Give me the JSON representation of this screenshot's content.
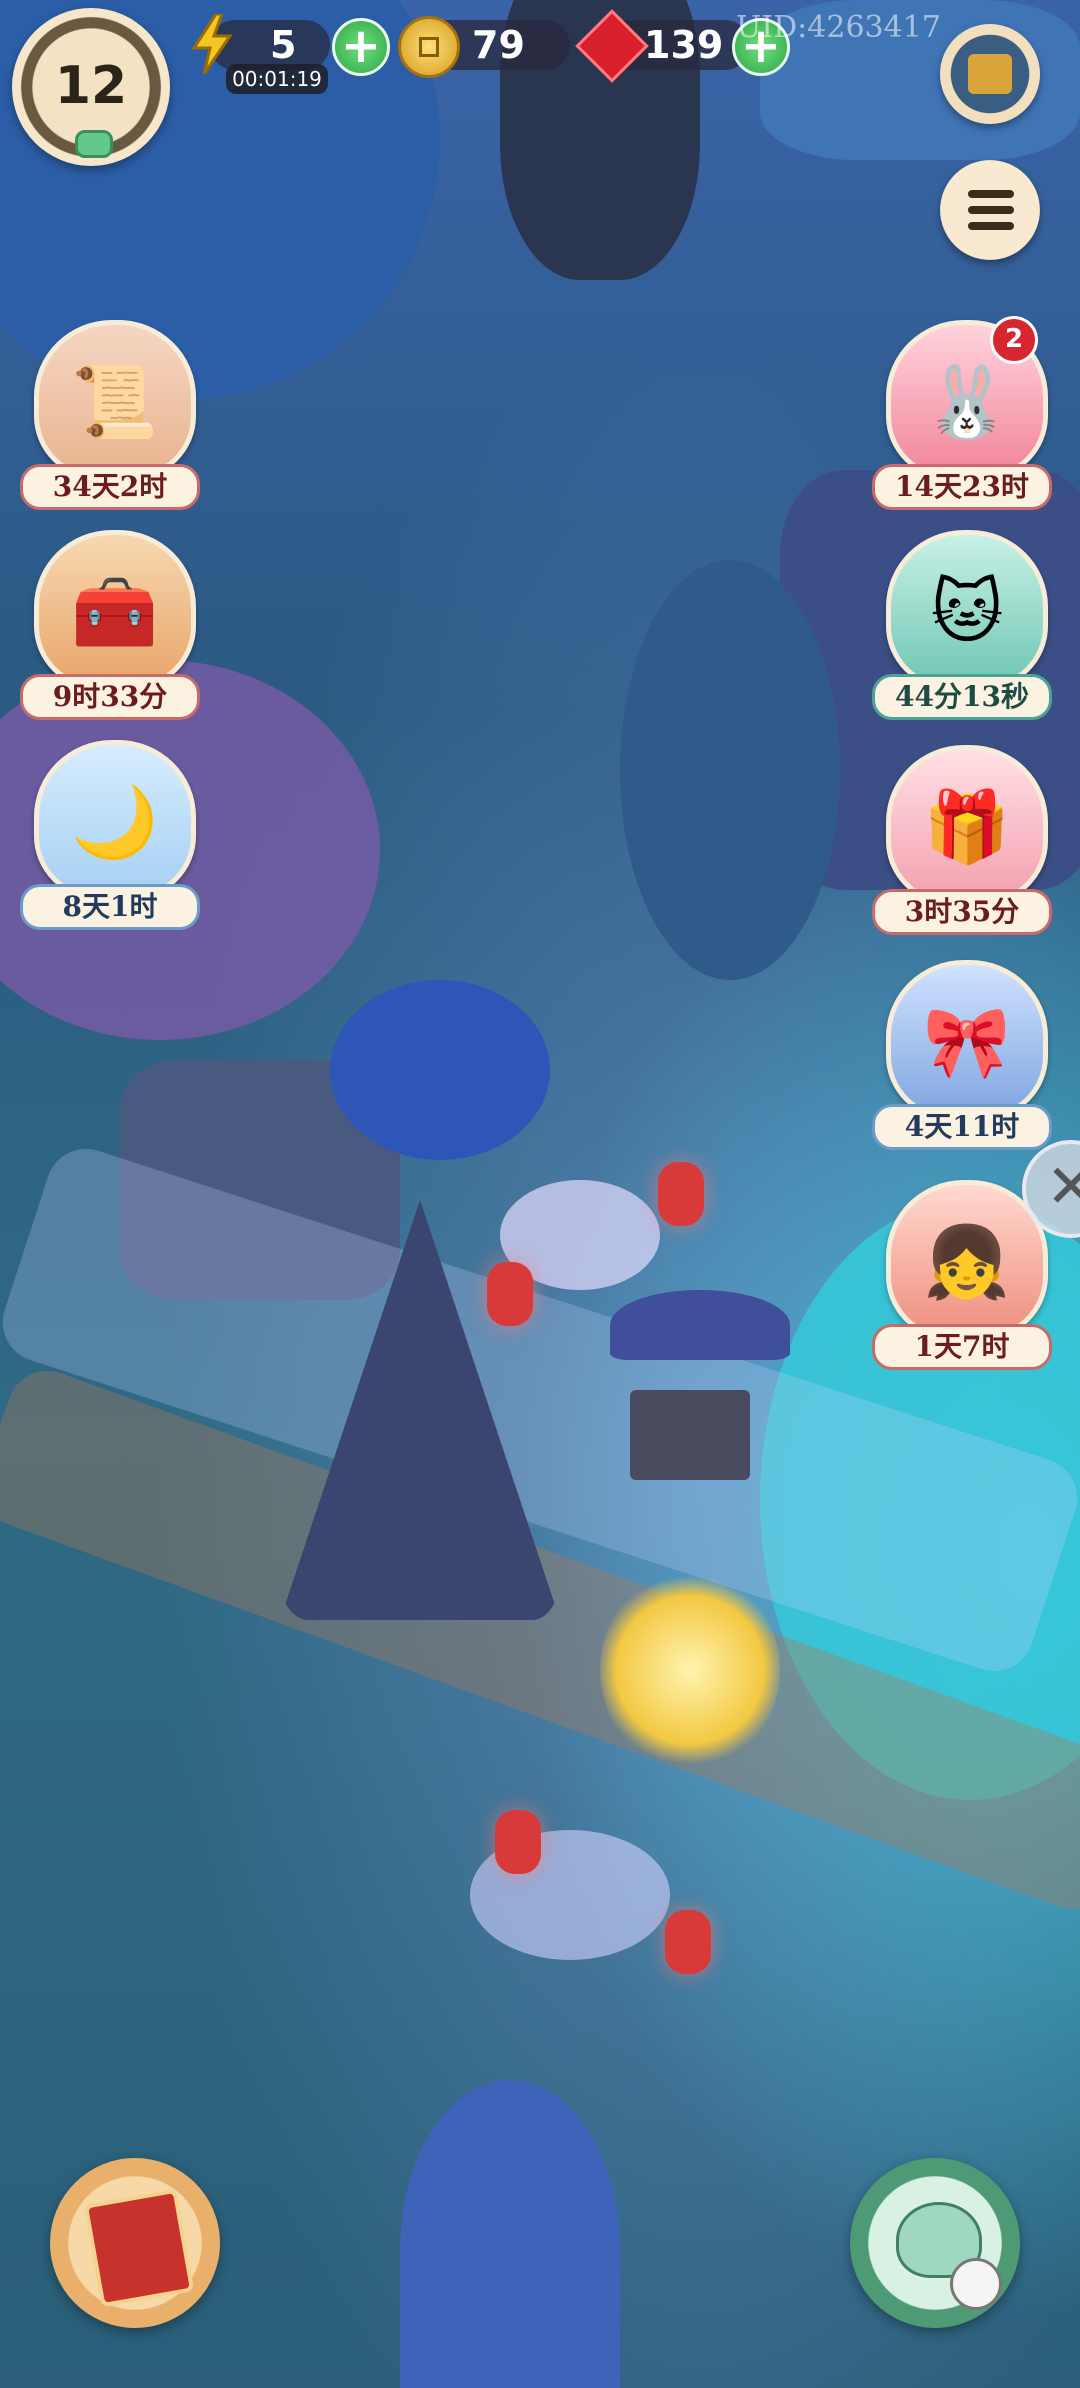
{
  "hud": {
    "level": "12",
    "energy": "5",
    "energy_timer": "00:01:19",
    "coins": "79",
    "gems": "139",
    "uid": "UID:4263417"
  },
  "events_left": [
    {
      "label": "34天2时",
      "icon": "scroll-gift-icon"
    },
    {
      "label": "9时33分",
      "icon": "treasure-chest-icon"
    },
    {
      "label": "8天1时",
      "icon": "moon-rabbit-icon"
    }
  ],
  "events_right": [
    {
      "label": "14天23时",
      "icon": "rabbit-icon",
      "badge": "2"
    },
    {
      "label": "44分13秒",
      "icon": "cat-coin-cart-icon"
    },
    {
      "label": "3时35分",
      "icon": "gift-box-icon"
    },
    {
      "label": "4天11时",
      "icon": "rabbit-chest-icon"
    },
    {
      "label": "1天7时",
      "icon": "character-girl-icon"
    }
  ],
  "buttons": {
    "shop": "shop-icon",
    "menu": "menu-list-icon",
    "book": "book-icon",
    "teapot": "teapot-icon",
    "close": "close-icon"
  }
}
